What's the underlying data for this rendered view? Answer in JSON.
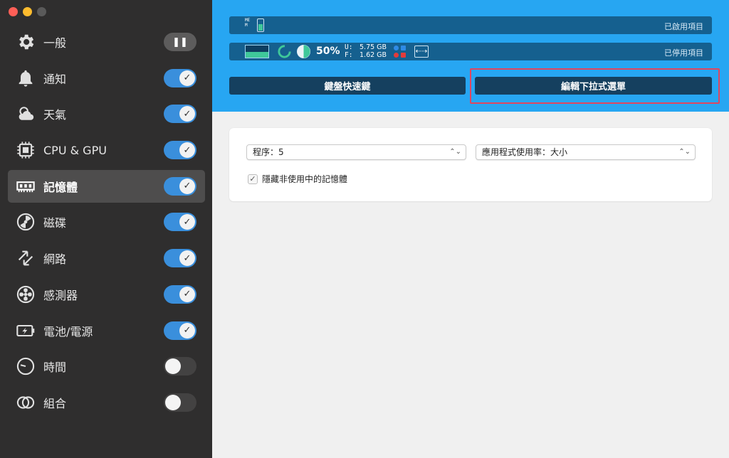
{
  "colors": {
    "sidebar_bg": "#2f2e2e",
    "active_item_bg": "#4e4d4d",
    "toggle_on": "#3a8fdc",
    "top_band": "#27a6f2",
    "bar_bg": "#15608f",
    "button_bg": "#15405f",
    "highlight_border": "#e0475f",
    "accent_green": "#3fc89a"
  },
  "sidebar": {
    "items": [
      {
        "label": "一般",
        "icon": "gear-icon",
        "toggle": "pause"
      },
      {
        "label": "通知",
        "icon": "bell-icon",
        "toggle": "on"
      },
      {
        "label": "天氣",
        "icon": "weather-icon",
        "toggle": "on"
      },
      {
        "label": "CPU & GPU",
        "icon": "cpu-icon",
        "toggle": "on"
      },
      {
        "label": "記憶體",
        "icon": "memory-icon",
        "toggle": "on",
        "active": true
      },
      {
        "label": "磁碟",
        "icon": "disk-icon",
        "toggle": "on"
      },
      {
        "label": "網路",
        "icon": "network-icon",
        "toggle": "on"
      },
      {
        "label": "感測器",
        "icon": "fan-icon",
        "toggle": "on"
      },
      {
        "label": "電池/電源",
        "icon": "battery-icon",
        "toggle": "on"
      },
      {
        "label": "時間",
        "icon": "clock-icon",
        "toggle": "off"
      },
      {
        "label": "組合",
        "icon": "combine-icon",
        "toggle": "off"
      }
    ],
    "pause_glyph": "❚❚",
    "check_glyph": "✓"
  },
  "menubar_preview": {
    "enabled_label": "已啟用項目",
    "disabled_label": "已停用項目",
    "mem_text": "MEM",
    "mem_level": 0.55,
    "graph_level": 0.45,
    "percent": "50%",
    "used_label": "U:",
    "free_label": "F:",
    "used_value": "5.75 GB",
    "free_value": "1.62 GB",
    "arrows_glyph": "⇠⇢"
  },
  "buttons": {
    "keyboard_shortcuts": "鍵盤快速鍵",
    "edit_dropdown": "編輯下拉式選單"
  },
  "settings": {
    "processes_select": "程序：5",
    "app_usage_select": "應用程式使用率：大小",
    "select_arrow": "⌃⌄",
    "hide_inactive_label": "隱藏非使用中的記憶體",
    "hide_inactive_checked": true
  }
}
